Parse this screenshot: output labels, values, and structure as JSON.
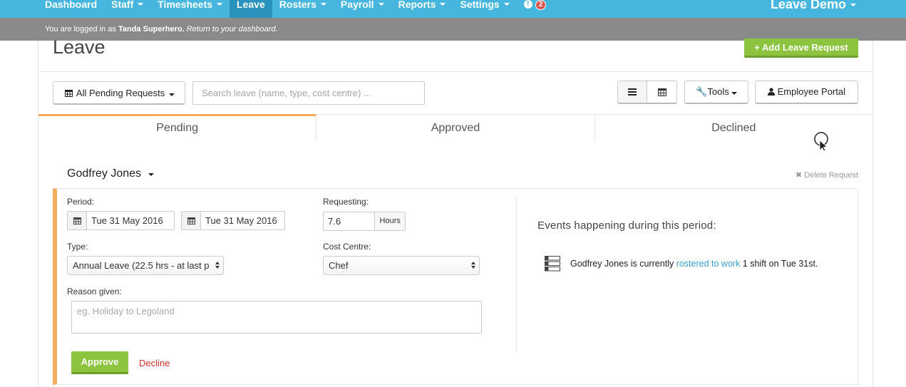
{
  "nav": {
    "items": [
      {
        "label": "Dashboard",
        "caret": false,
        "active": false
      },
      {
        "label": "Staff",
        "caret": true,
        "active": false
      },
      {
        "label": "Timesheets",
        "caret": true,
        "active": false
      },
      {
        "label": "Leave",
        "caret": false,
        "active": true
      },
      {
        "label": "Rosters",
        "caret": true,
        "active": false
      },
      {
        "label": "Payroll",
        "caret": true,
        "active": false
      },
      {
        "label": "Reports",
        "caret": true,
        "active": false
      },
      {
        "label": "Settings",
        "caret": true,
        "active": false
      }
    ],
    "alert_icon": "!",
    "alert_count": "2",
    "brand": "Leave Demo"
  },
  "login_bar": {
    "prefix": "You are logged in as",
    "user": "Tanda Superhero.",
    "link": "Return to your dashboard."
  },
  "page": {
    "title": "Leave",
    "add_button": "Add Leave Request"
  },
  "toolbar": {
    "filter_label": "All Pending Requests",
    "search_placeholder": "Search leave (name, type, cost centre) ...",
    "tools_label": "Tools",
    "portal_label": "Employee Portal"
  },
  "tabs": [
    {
      "label": "Pending",
      "active": true
    },
    {
      "label": "Approved",
      "active": false
    },
    {
      "label": "Declined",
      "active": false
    }
  ],
  "request": {
    "employee": "Godfrey Jones",
    "delete_label": "Delete Request",
    "period_label": "Period:",
    "start_date": "Tue 31 May 2016",
    "end_date": "Tue 31 May 2016",
    "requesting_label": "Requesting:",
    "hours_value": "7.6",
    "hours_unit": "Hours",
    "type_label": "Type:",
    "type_value": "Annual Leave (22.5 hrs - at last p",
    "cost_centre_label": "Cost Centre:",
    "cost_centre_value": "Chef",
    "reason_label": "Reason given:",
    "reason_placeholder": "eg. Holiday to Legoland",
    "approve_label": "Approve",
    "decline_label": "Decline",
    "events_title": "Events happening during this period:",
    "event_prefix": "Godfrey Jones is currently",
    "event_link": "rostered to work",
    "event_suffix": "1 shift on Tue 31st."
  },
  "colors": {
    "nav_bg": "#46b6df",
    "accent_green": "#8cc43f",
    "pending_orange": "#f6ad5b",
    "link_blue": "#3aa0cc",
    "decline_red": "#c9302c"
  }
}
